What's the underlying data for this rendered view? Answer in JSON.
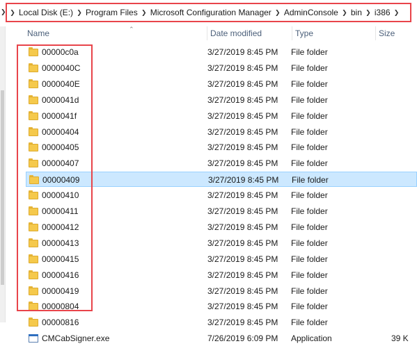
{
  "address_bar": {
    "crumbs": [
      "Local Disk (E:)",
      "Program Files",
      "Microsoft Configuration Manager",
      "AdminConsole",
      "bin",
      "i386"
    ]
  },
  "columns": {
    "name": "Name",
    "date": "Date modified",
    "type": "Type",
    "size": "Size"
  },
  "rows": [
    {
      "name": "00000c0a",
      "date": "3/27/2019 8:45 PM",
      "type": "File folder",
      "size": "",
      "icon": "folder-icon"
    },
    {
      "name": "0000040C",
      "date": "3/27/2019 8:45 PM",
      "type": "File folder",
      "size": "",
      "icon": "folder-icon"
    },
    {
      "name": "0000040E",
      "date": "3/27/2019 8:45 PM",
      "type": "File folder",
      "size": "",
      "icon": "folder-icon"
    },
    {
      "name": "0000041d",
      "date": "3/27/2019 8:45 PM",
      "type": "File folder",
      "size": "",
      "icon": "folder-icon"
    },
    {
      "name": "0000041f",
      "date": "3/27/2019 8:45 PM",
      "type": "File folder",
      "size": "",
      "icon": "folder-icon"
    },
    {
      "name": "00000404",
      "date": "3/27/2019 8:45 PM",
      "type": "File folder",
      "size": "",
      "icon": "folder-icon"
    },
    {
      "name": "00000405",
      "date": "3/27/2019 8:45 PM",
      "type": "File folder",
      "size": "",
      "icon": "folder-icon"
    },
    {
      "name": "00000407",
      "date": "3/27/2019 8:45 PM",
      "type": "File folder",
      "size": "",
      "icon": "folder-icon"
    },
    {
      "name": "00000409",
      "date": "3/27/2019 8:45 PM",
      "type": "File folder",
      "size": "",
      "icon": "folder-icon",
      "selected": true
    },
    {
      "name": "00000410",
      "date": "3/27/2019 8:45 PM",
      "type": "File folder",
      "size": "",
      "icon": "folder-icon"
    },
    {
      "name": "00000411",
      "date": "3/27/2019 8:45 PM",
      "type": "File folder",
      "size": "",
      "icon": "folder-icon"
    },
    {
      "name": "00000412",
      "date": "3/27/2019 8:45 PM",
      "type": "File folder",
      "size": "",
      "icon": "folder-icon"
    },
    {
      "name": "00000413",
      "date": "3/27/2019 8:45 PM",
      "type": "File folder",
      "size": "",
      "icon": "folder-icon"
    },
    {
      "name": "00000415",
      "date": "3/27/2019 8:45 PM",
      "type": "File folder",
      "size": "",
      "icon": "folder-icon"
    },
    {
      "name": "00000416",
      "date": "3/27/2019 8:45 PM",
      "type": "File folder",
      "size": "",
      "icon": "folder-icon"
    },
    {
      "name": "00000419",
      "date": "3/27/2019 8:45 PM",
      "type": "File folder",
      "size": "",
      "icon": "folder-icon"
    },
    {
      "name": "00000804",
      "date": "3/27/2019 8:45 PM",
      "type": "File folder",
      "size": "",
      "icon": "folder-icon"
    },
    {
      "name": "00000816",
      "date": "3/27/2019 8:45 PM",
      "type": "File folder",
      "size": "",
      "icon": "folder-icon"
    },
    {
      "name": "CMCabSigner.exe",
      "date": "7/26/2019 6:09 PM",
      "type": "Application",
      "size": "39 K",
      "icon": "application-icon"
    }
  ],
  "colors": {
    "highlight_border": "#e8444a",
    "selection_bg": "#cce8ff",
    "selection_border": "#99d1ff",
    "header_text": "#4c607a"
  }
}
